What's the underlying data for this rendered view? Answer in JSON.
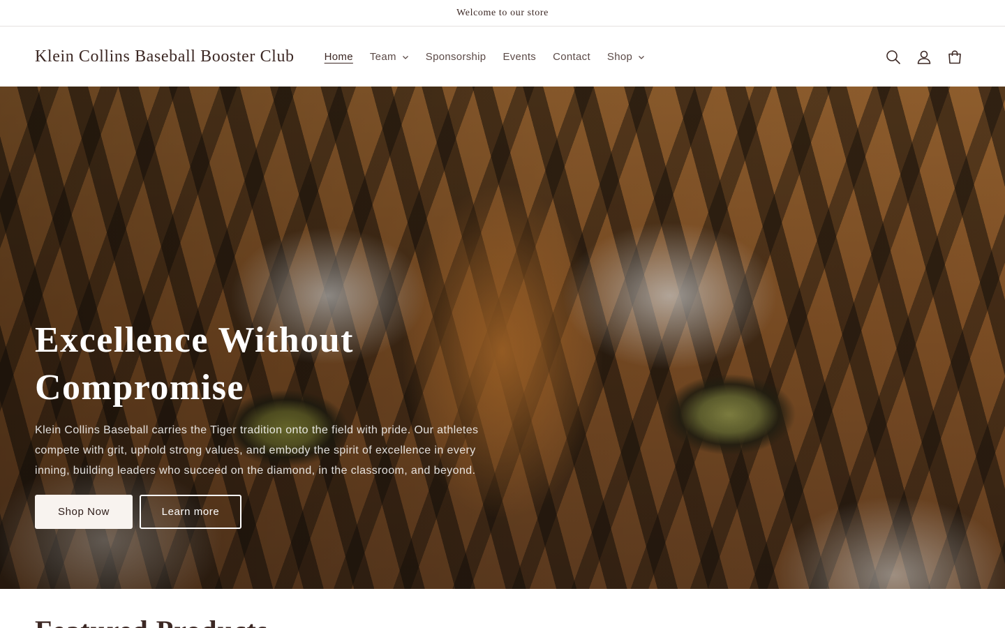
{
  "announcement": {
    "text": "Welcome to our store"
  },
  "header": {
    "logo": "Klein Collins Baseball Booster Club",
    "nav": [
      {
        "label": "Home",
        "active": true,
        "dropdown": false
      },
      {
        "label": "Team",
        "active": false,
        "dropdown": true
      },
      {
        "label": "Sponsorship",
        "active": false,
        "dropdown": false
      },
      {
        "label": "Events",
        "active": false,
        "dropdown": false
      },
      {
        "label": "Contact",
        "active": false,
        "dropdown": false
      },
      {
        "label": "Shop",
        "active": false,
        "dropdown": true
      }
    ],
    "icons": [
      "search-icon",
      "account-icon",
      "cart-icon"
    ]
  },
  "hero": {
    "title": "Excellence Without Compromise",
    "text": "Klein Collins Baseball carries the Tiger tradition onto the field with pride. Our athletes compete with grit, uphold strong values, and embody the spirit of excellence in every inning, building leaders who succeed on the diamond, in the classroom, and beyond.",
    "primary_button": "Shop Now",
    "secondary_button": "Learn more",
    "image": "tiger-face"
  },
  "featured": {
    "title": "Featured Products"
  },
  "colors": {
    "text": "#3c2824",
    "button_bg": "#f8f3ef"
  }
}
